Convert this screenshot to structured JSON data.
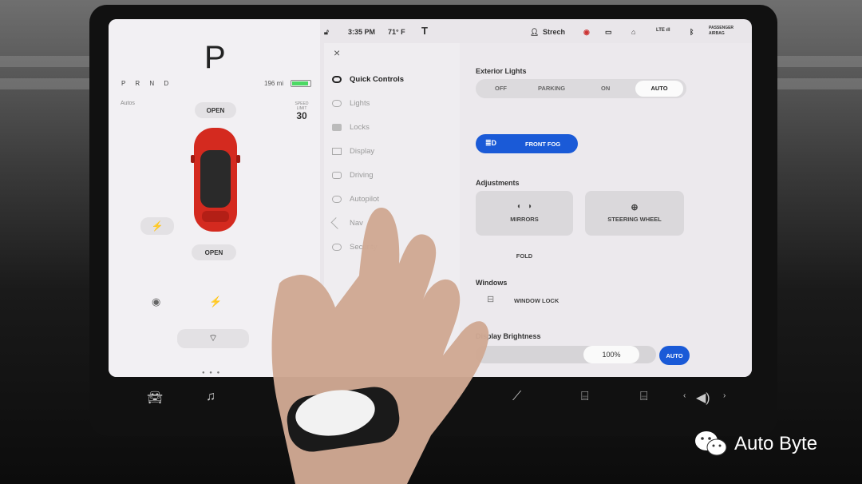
{
  "status": {
    "time": "3:35 PM",
    "temperature": "71° F",
    "user": "Strech",
    "passenger_airbag": "PASSENGER AIRBAG"
  },
  "left": {
    "gear": "P",
    "gear_row": "P R N D",
    "range": "196 mi",
    "speed_limit_label": "SPEED LIMIT",
    "speed_limit": "30",
    "auto_label": "Autos",
    "frunk": "OPEN",
    "trunk": "OPEN"
  },
  "menu": {
    "close": "×",
    "items": [
      {
        "label": "Quick Controls",
        "icon": "toggle-icon"
      },
      {
        "label": "Lights",
        "icon": "bulb-icon"
      },
      {
        "label": "Locks",
        "icon": "lock-icon"
      },
      {
        "label": "Display",
        "icon": "display-icon"
      },
      {
        "label": "Driving",
        "icon": "car-icon"
      },
      {
        "label": "Autopilot",
        "icon": "steering-icon"
      },
      {
        "label": "Nav",
        "icon": "navigation-icon"
      },
      {
        "label": "Security",
        "icon": "shield-icon"
      }
    ]
  },
  "quick": {
    "exterior_title": "Exterior Lights",
    "light_modes": [
      "OFF",
      "PARKING",
      "ON",
      "AUTO"
    ],
    "selected_mode": "AUTO",
    "front_fog": "FRONT FOG",
    "adjustments_title": "Adjustments",
    "mirrors": "MIRRORS",
    "steering_wheel": "STEERING WHEEL",
    "fold": "FOLD",
    "windows_title": "Windows",
    "window_lock": "WINDOW LOCK",
    "brightness_title": "Display Brightness",
    "brightness_value": "100%",
    "brightness_auto": "AUTO"
  },
  "watermark": "Auto Byte",
  "colors": {
    "accent": "#1a5ad7",
    "car": "#d42a1f",
    "battery": "#4cd964"
  }
}
